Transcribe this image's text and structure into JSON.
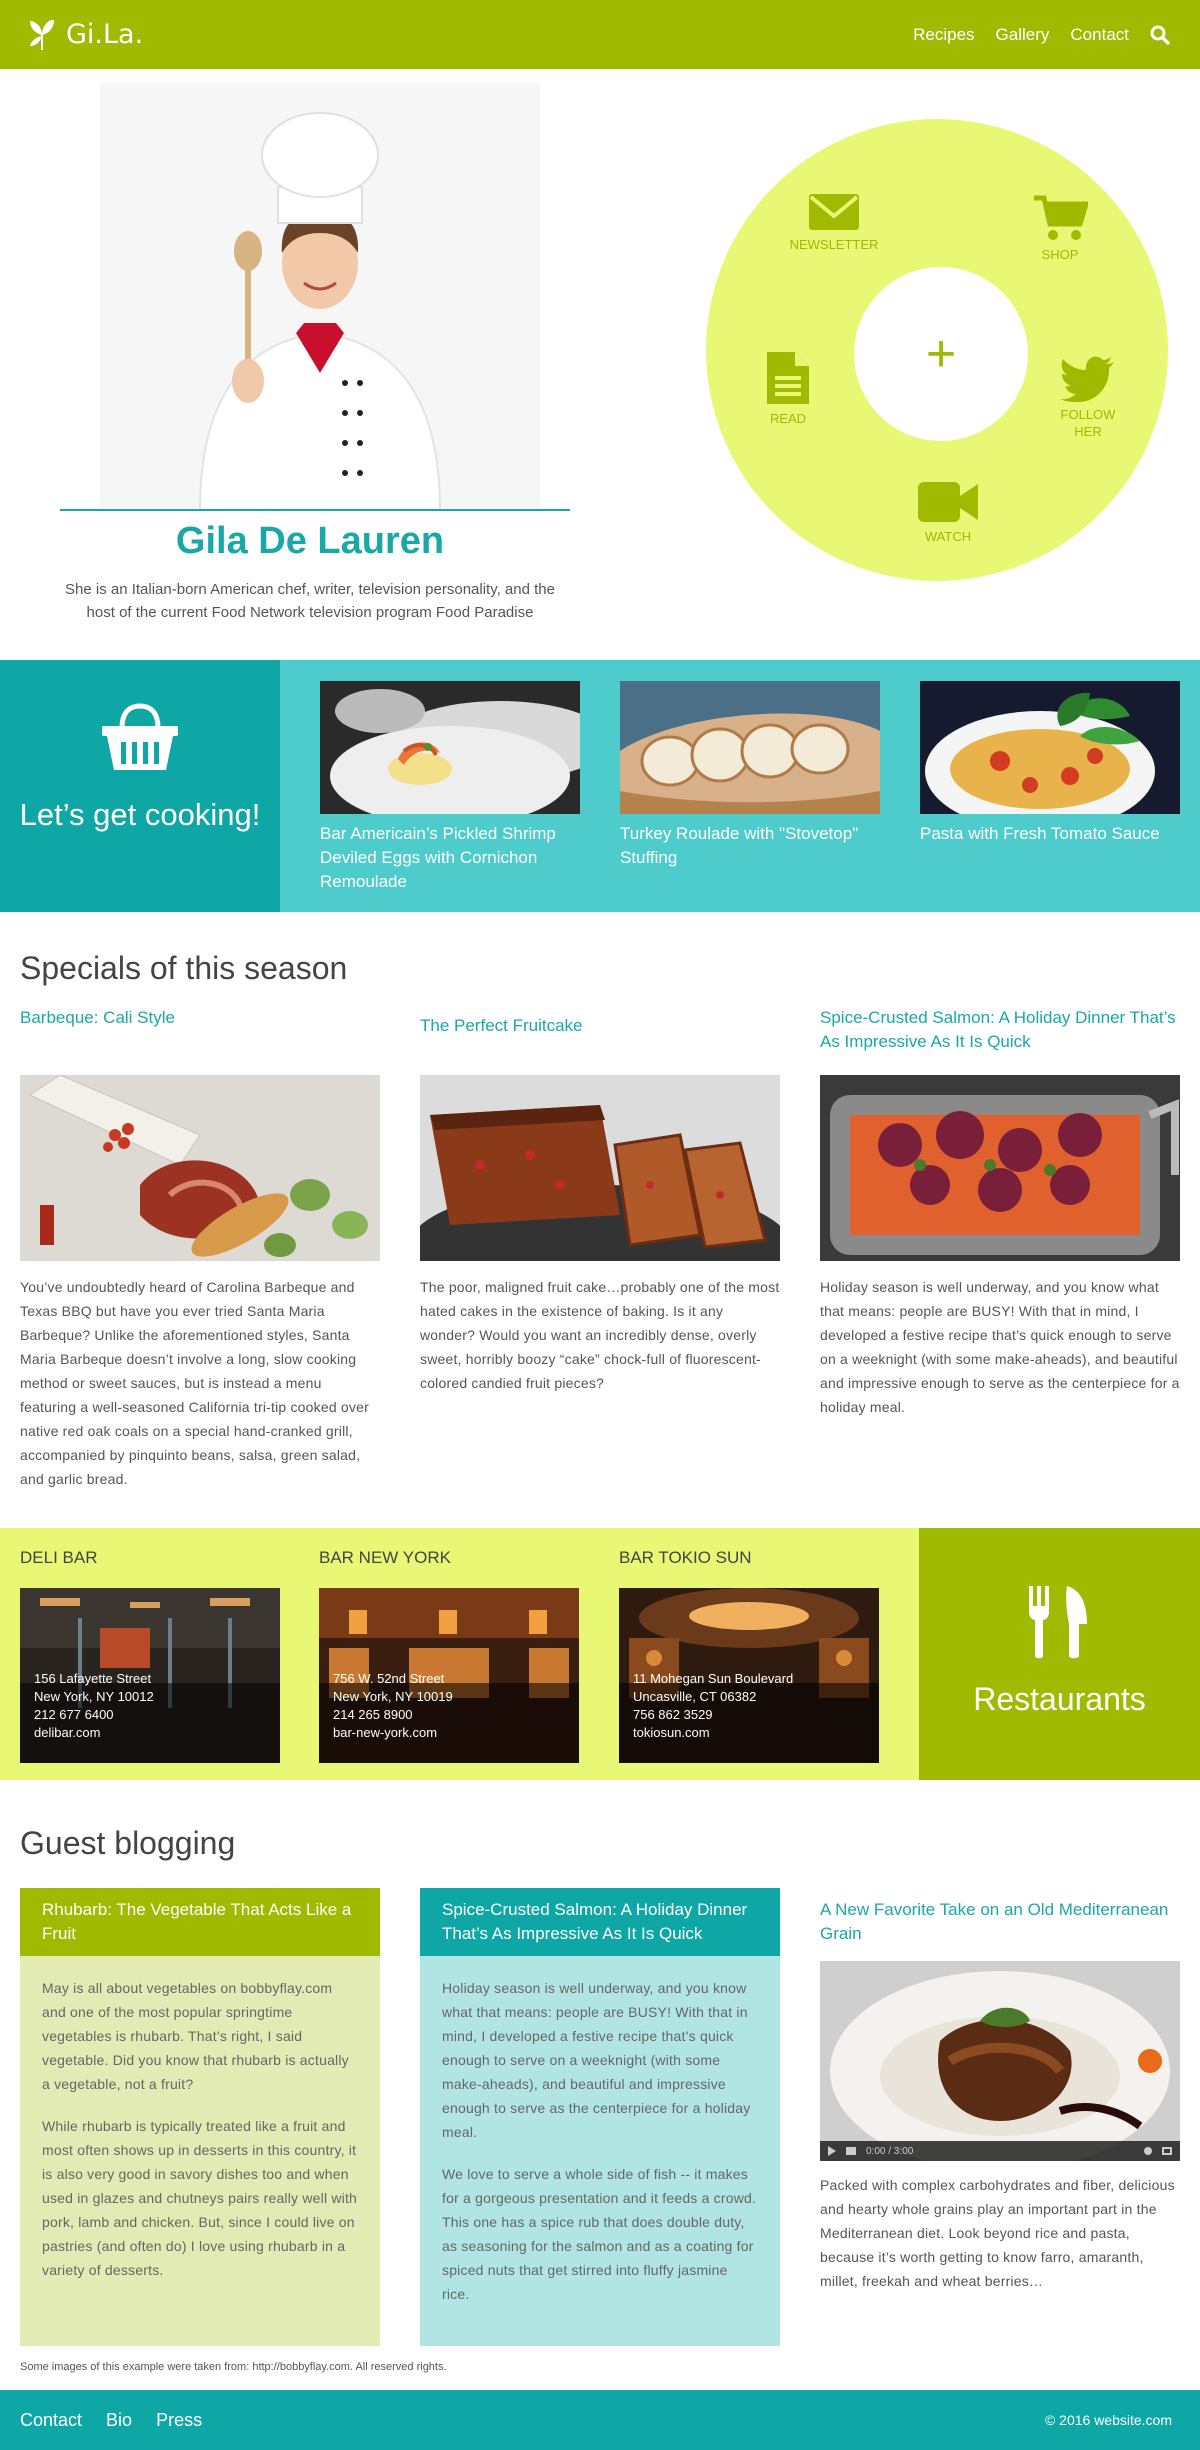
{
  "header": {
    "logo_text": "Gi.La.",
    "nav": [
      "Recipes",
      "Gallery",
      "Contact"
    ],
    "search_icon": "search-icon"
  },
  "hero": {
    "name": "Gila De Lauren",
    "description": "She is an Italian-born American chef, writer, television personality, and the host of the current Food Network television program Food Paradise"
  },
  "wheel": {
    "center": "+",
    "items": {
      "newsletter": "NEWSLETTER",
      "shop": "SHOP",
      "read": "READ",
      "follow": "FOLLOW HER",
      "watch": "WATCH"
    }
  },
  "cooking": {
    "title": "Let’s get cooking!",
    "items": [
      "Bar Americain’s Pickled Shrimp Deviled Eggs with Cornichon Remoulade",
      "Turkey Roulade with \"Stovetop\" Stuffing",
      "Pasta with Fresh Tomato Sauce"
    ]
  },
  "specials": {
    "heading": "Specials of this season",
    "items": [
      {
        "title": "Barbeque: Cali Style",
        "text": "You’ve undoubtedly heard of Carolina Barbeque and Texas BBQ but have you ever tried Santa Maria Barbeque? Unlike the aforementioned styles, Santa Maria Barbeque doesn’t involve a long, slow cooking method or sweet sauces, but is instead a menu featuring a well-seasoned California tri-tip cooked over native red oak coals on a special hand-cranked grill, accompanied by pinquinto beans, salsa, green salad, and garlic bread."
      },
      {
        "title": "The Perfect Fruitcake",
        "text": "The poor, maligned fruit cake…probably one of the most hated cakes in the existence of baking. Is it any wonder? Would you want an incredibly dense, overly sweet, horribly boozy “cake” chock-full of fluorescent-colored candied fruit pieces?"
      },
      {
        "title": "Spice-Crusted Salmon: A Holiday Dinner That’s As Impressive As It Is Quick",
        "text": "Holiday season is well underway, and you know what that means: people are BUSY! With that in mind, I developed a festive recipe that’s quick enough to serve on a weeknight (with some make-aheads), and beautiful and impressive enough to serve as the centerpiece for a holiday meal."
      }
    ]
  },
  "restaurants": {
    "title": "Restaurants",
    "items": [
      {
        "name": "DELI BAR",
        "address": "156 Lafayette Street",
        "city": "New York, NY 10012",
        "phone": "212 677 6400",
        "site": "delibar.com"
      },
      {
        "name": "BAR NEW YORK",
        "address": "756 W. 52nd Street",
        "city": "New York, NY 10019",
        "phone": "214 265 8900",
        "site": "bar-new-york.com"
      },
      {
        "name": "BAR TOKIO SUN",
        "address": "11 Mohegan Sun Boulevard",
        "city": "Uncasville, CT 06382",
        "phone": "756 862 3529",
        "site": "tokiosun.com"
      }
    ]
  },
  "guest": {
    "heading": "Guest blogging",
    "col1": {
      "title": "Rhubarb: The Vegetable That Acts Like a Fruit",
      "p1": "May is all about vegetables on bobbyflay.com and one of the most popular springtime vegetables is rhubarb. That’s right, I said vegetable. Did you know that rhubarb is actually a vegetable, not a fruit?",
      "p2": "While rhubarb is typically treated like a fruit and most often shows up in desserts in this country, it is also very good in savory dishes too and when used in glazes and chutneys pairs really well with pork, lamb and chicken. But, since I could live on pastries (and often do) I love using rhubarb in a variety of desserts."
    },
    "col2": {
      "title": "Spice-Crusted Salmon: A Holiday Dinner That’s As Impressive As It Is Quick",
      "p1": "Holiday season is well underway, and you know what that means: people are BUSY! With that in mind, I developed a festive recipe that’s quick enough to serve on a weeknight (with some make-aheads), and beautiful and impressive enough to serve as the centerpiece for a holiday meal.",
      "p2": "We love to serve a whole side of fish -- it makes for a gorgeous presentation and it feeds a crowd. This one has a spice rub that does double duty, as seasoning for the salmon and as a coating for spiced nuts that get stirred into fluffy jasmine rice."
    },
    "col3": {
      "title": "A New Favorite Take on an Old Mediterranean Grain",
      "video_time": "0:00 / 3:00",
      "text": "Packed with complex carbohydrates and fiber, delicious and hearty whole grains play an important part in the Mediterranean diet. Look beyond rice and pasta, because it’s worth getting to know farro, amaranth, millet, freekah and wheat berries…"
    }
  },
  "note": "Some images of this example were taken from: http://bobbyflay.com. All reserved rights.",
  "footer": {
    "nav": [
      "Contact",
      "Bio",
      "Press"
    ],
    "copyright": "© 2016 website.com"
  },
  "colors": {
    "lime": "#9fba00",
    "light_lime": "#e8f774",
    "teal": "#0fa6a6",
    "light_teal": "#4ecbcb"
  }
}
